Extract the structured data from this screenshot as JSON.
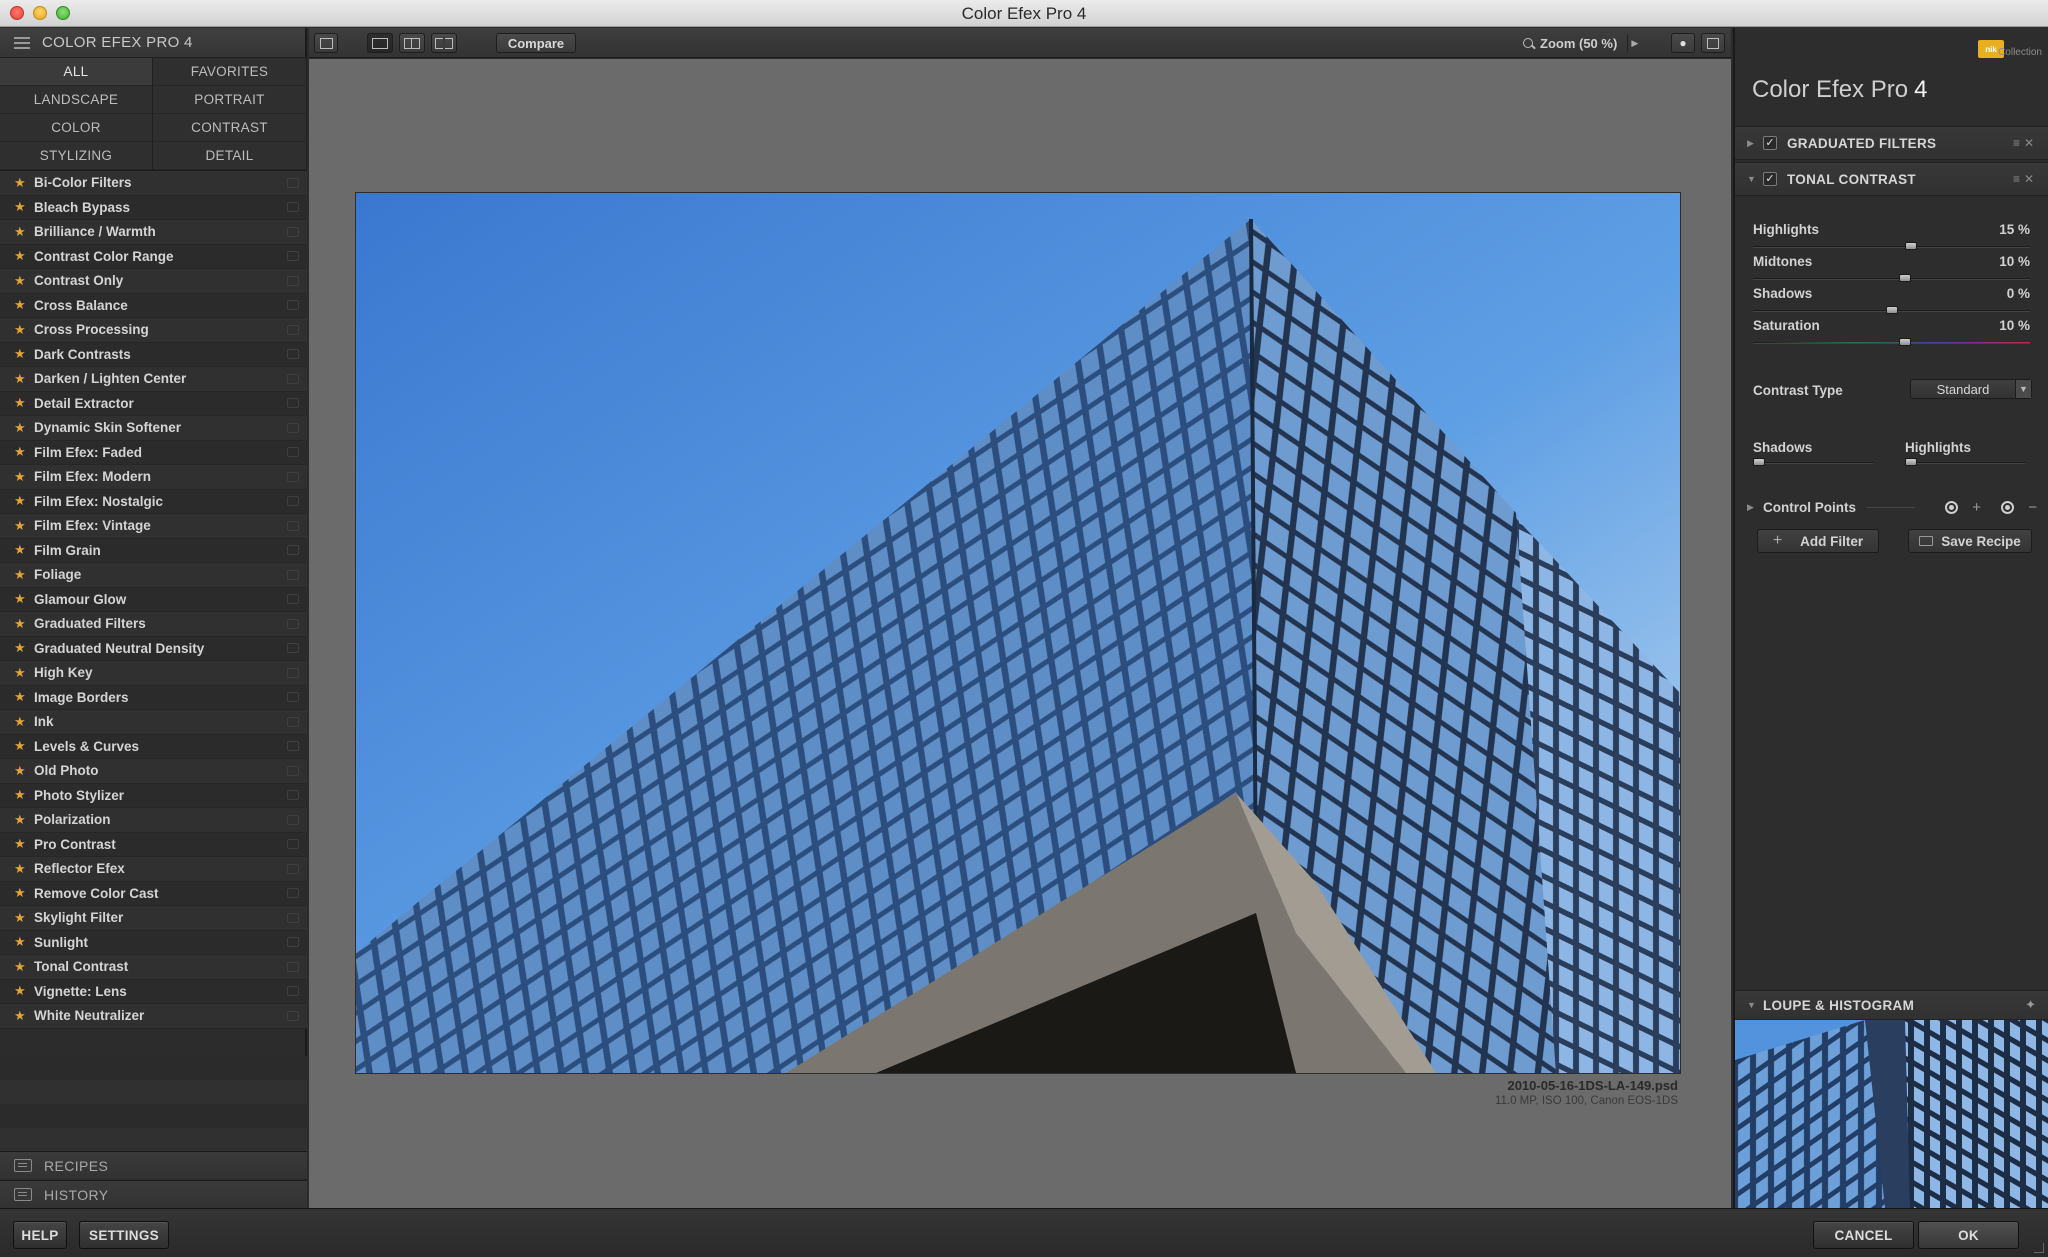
{
  "window": {
    "title": "Color Efex Pro 4"
  },
  "left_panel": {
    "header": "COLOR EFEX PRO 4",
    "categories": [
      "ALL",
      "FAVORITES",
      "LANDSCAPE",
      "PORTRAIT",
      "COLOR",
      "CONTRAST",
      "STYLIZING",
      "DETAIL"
    ],
    "active_category": "ALL",
    "filters": [
      "Bi-Color Filters",
      "Bleach Bypass",
      "Brilliance / Warmth",
      "Contrast Color Range",
      "Contrast Only",
      "Cross Balance",
      "Cross Processing",
      "Dark Contrasts",
      "Darken / Lighten Center",
      "Detail Extractor",
      "Dynamic Skin Softener",
      "Film Efex: Faded",
      "Film Efex: Modern",
      "Film Efex: Nostalgic",
      "Film Efex: Vintage",
      "Film Grain",
      "Foliage",
      "Glamour Glow",
      "Graduated Filters",
      "Graduated Neutral Density",
      "High Key",
      "Image Borders",
      "Ink",
      "Levels & Curves",
      "Old Photo",
      "Photo Stylizer",
      "Polarization",
      "Pro Contrast",
      "Reflector Efex",
      "Remove Color Cast",
      "Skylight Filter",
      "Sunlight",
      "Tonal Contrast",
      "Vignette: Lens",
      "White Neutralizer"
    ],
    "sections": {
      "recipes": "RECIPES",
      "history": "HISTORY"
    }
  },
  "toolbar": {
    "compare_label": "Compare",
    "zoom_label": "Zoom (50 %)"
  },
  "image": {
    "file_name": "2010-05-16-1DS-LA-149.psd",
    "meta": "11.0 MP, ISO 100, Canon EOS-1DS"
  },
  "right_panel": {
    "brand_logo": "nik",
    "brand_collection": "Collection",
    "title_main": "Color Efex Pro",
    "title_version": "4",
    "filters_stack": [
      {
        "name": "GRADUATED FILTERS",
        "enabled": true,
        "expanded": false
      },
      {
        "name": "TONAL CONTRAST",
        "enabled": true,
        "expanded": true
      }
    ],
    "tonal_contrast": {
      "sliders": [
        {
          "label": "Highlights",
          "value": "15 %",
          "fraction": 0.57
        },
        {
          "label": "Midtones",
          "value": "10 %",
          "fraction": 0.55
        },
        {
          "label": "Shadows",
          "value": "0 %",
          "fraction": 0.5
        },
        {
          "label": "Saturation",
          "value": "10 %",
          "fraction": 0.55
        }
      ],
      "contrast_type_label": "Contrast Type",
      "contrast_type_value": "Standard",
      "mini_sliders": [
        {
          "label": "Shadows",
          "fraction": 0.05
        },
        {
          "label": "Highlights",
          "fraction": 0.05
        }
      ],
      "control_points_label": "Control Points"
    },
    "add_filter_label": "Add Filter",
    "save_recipe_label": "Save Recipe",
    "loupe_label": "LOUPE & HISTOGRAM"
  },
  "bottom_bar": {
    "help": "HELP",
    "settings": "SETTINGS",
    "cancel": "CANCEL",
    "ok": "OK"
  },
  "colors": {
    "accent_star": "#e0a43a",
    "sky_top": "#3f7fd4",
    "sky_bottom": "#a9cdef",
    "brand": "#e8b021"
  }
}
